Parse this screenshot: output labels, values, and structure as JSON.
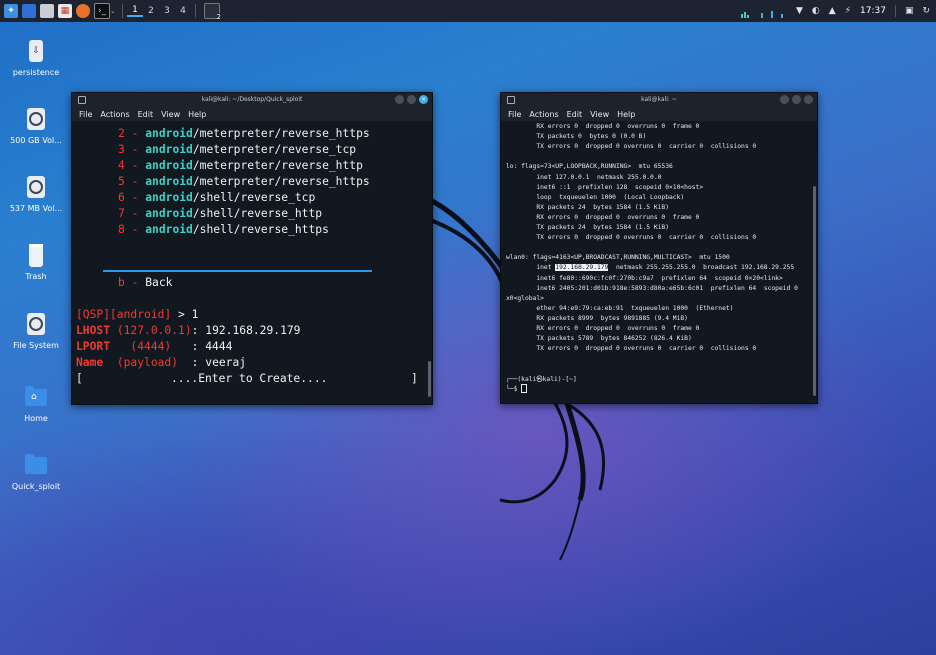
{
  "panel": {
    "workspaces": [
      "1",
      "2",
      "3",
      "4"
    ],
    "badge": "2",
    "time": "17:37"
  },
  "desktop_icons": [
    {
      "label": "persistence",
      "icon": "usb-drive-icon"
    },
    {
      "label": "500 GB Vol...",
      "icon": "drive-icon"
    },
    {
      "label": "537 MB Vol...",
      "icon": "drive-icon"
    },
    {
      "label": "Trash",
      "icon": "trash-icon"
    },
    {
      "label": "File System",
      "icon": "drive-icon"
    },
    {
      "label": "Home",
      "icon": "home-folder-icon"
    },
    {
      "label": "Quick_sploit",
      "icon": "folder-icon"
    }
  ],
  "window_left": {
    "title": "kali@kali: ~/Desktop/Quick_sploit",
    "menu": [
      "File",
      "Actions",
      "Edit",
      "View",
      "Help"
    ],
    "options": [
      {
        "num": "2",
        "dash": "-",
        "platform": "android",
        "path": "/meterpreter/reverse_https"
      },
      {
        "num": "3",
        "dash": "-",
        "platform": "android",
        "path": "/meterpreter/reverse_tcp"
      },
      {
        "num": "4",
        "dash": "-",
        "platform": "android",
        "path": "/meterpreter/reverse_http"
      },
      {
        "num": "5",
        "dash": "-",
        "platform": "android",
        "path": "/meterpreter/reverse_https"
      },
      {
        "num": "6",
        "dash": "-",
        "platform": "android",
        "path": "/shell/reverse_tcp"
      },
      {
        "num": "7",
        "dash": "-",
        "platform": "android",
        "path": "/shell/reverse_http"
      },
      {
        "num": "8",
        "dash": "-",
        "platform": "android",
        "path": "/shell/reverse_https"
      }
    ],
    "back": {
      "key": "b",
      "dash": "-",
      "label": "Back"
    },
    "prompt": {
      "bracket": "[QSP][android]",
      "arrow": " > ",
      "input": "1"
    },
    "fields": [
      {
        "name": "LHOST",
        "default": "(127.0.0.1)",
        "sep": ": ",
        "value": "192.168.29.179"
      },
      {
        "name": "LPORT",
        "default": "(4444)",
        "sep": ": ",
        "value": "4444"
      },
      {
        "name": "Name",
        "default": "(payload)",
        "sep": ": ",
        "value": "veeraj"
      }
    ],
    "create": {
      "open": "[",
      "text": "....Enter to Create....",
      "close": "]"
    }
  },
  "window_right": {
    "title": "kali@kali: ~",
    "menu": [
      "File",
      "Actions",
      "Edit",
      "View",
      "Help"
    ],
    "lines": [
      "        RX errors 0  dropped 0  overruns 0  frame 0",
      "        TX packets 0  bytes 0 (0.0 B)",
      "        TX errors 0  dropped 0 overruns 0  carrier 0  collisions 0",
      "",
      "lo: flags=73<UP,LOOPBACK,RUNNING>  mtu 65536",
      "        inet 127.0.0.1  netmask 255.0.0.0",
      "        inet6 ::1  prefixlen 128  scopeid 0×10<host>",
      "        loop  txqueuelen 1000  (Local Loopback)",
      "        RX packets 24  bytes 1584 (1.5 KiB)",
      "        RX errors 0  dropped 0  overruns 0  frame 0",
      "        TX packets 24  bytes 1584 (1.5 KiB)",
      "        TX errors 0  dropped 0 overruns 0  carrier 0  collisions 0",
      "",
      "wlan0: flags=4163<UP,BROADCAST,RUNNING,MULTICAST>  mtu 1500"
    ],
    "inet": {
      "pre": "        inet ",
      "hl": "192.168.29.179",
      "post": "  netmask 255.255.255.0  broadcast 192.168.29.255"
    },
    "lines2": [
      "        inet6 fe80::690c:fc0f:270b:c9a7  prefixlen 64  scopeid 0×20<link>",
      "        inet6 2405:201:d01b:918e:5893:d80a:e65b:6c01  prefixlen 64  scopeid 0",
      "x0<global>",
      "        ether 94:e9:79:ca:eb:91  txqueuelen 1000  (Ethernet)",
      "        RX packets 8999  bytes 9891885 (9.4 MiB)",
      "        RX errors 0  dropped 0  overruns 0  frame 0",
      "        TX packets 5789  bytes 846252 (826.4 KiB)",
      "        TX errors 0  dropped 0 overruns 0  carrier 0  collisions 0"
    ],
    "prompt1": "┌──(kali㉿kali)-[~]",
    "prompt2": "└─$ "
  },
  "colors": {
    "accent": "#3daee9",
    "red": "#ef3b32",
    "cyan": "#3fd0c2",
    "panel": "#1d2330"
  }
}
